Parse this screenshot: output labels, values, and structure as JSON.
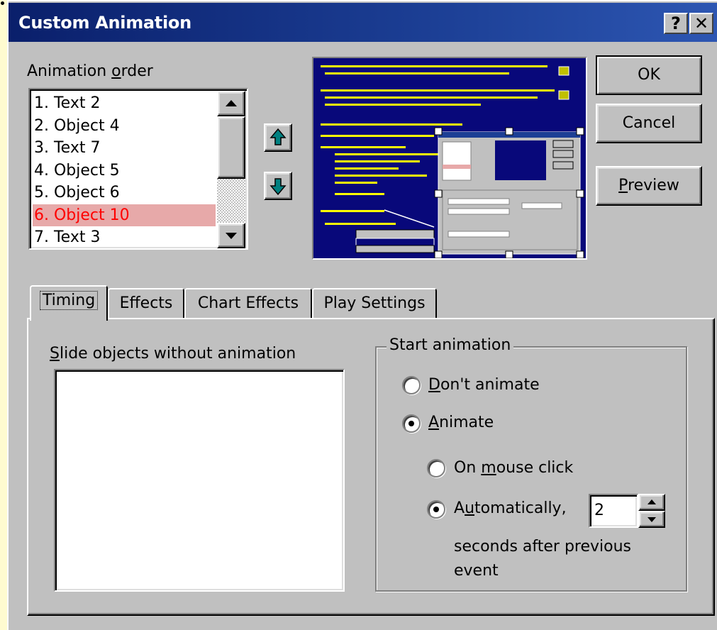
{
  "dialog": {
    "title": "Custom Animation",
    "help_glyph": "?",
    "close_glyph": "✕"
  },
  "animation_order": {
    "label_prefix": "Animation ",
    "label_accel": "o",
    "label_suffix": "rder",
    "items": [
      "1. Text 2",
      "2. Object 4",
      "3. Text 7",
      "4. Object 5",
      "5. Object 6",
      "6. Object 10",
      "7. Text 3"
    ],
    "selected_index": 5
  },
  "buttons": {
    "ok": "OK",
    "cancel": "Cancel",
    "preview_accel": "P",
    "preview_rest": "review"
  },
  "tabs": [
    "Timing",
    "Effects",
    "Chart Effects",
    "Play Settings"
  ],
  "timing": {
    "objects_label_accel": "S",
    "objects_label_rest": "lide objects without animation",
    "start_group_title": "Start animation",
    "dont_animate_accel": "D",
    "dont_animate_rest": "on't animate",
    "animate_accel": "A",
    "animate_rest": "nimate",
    "on_click_prefix": "On ",
    "on_click_accel": "m",
    "on_click_rest": "ouse click",
    "auto_prefix": "A",
    "auto_accel": "u",
    "auto_rest": "tomatically,",
    "seconds_value": "2",
    "seconds_line1": "seconds after previous",
    "seconds_line2": "event",
    "animate_selected": true,
    "automatic_selected": true
  },
  "colors": {
    "title_bar": "#0a1f6b",
    "selected_item_bg": "#e7a9a9",
    "selected_item_text": "#ff0000",
    "preview_bg": "#08087a",
    "preview_text": "#ffff00"
  },
  "icons": [
    "help-icon",
    "close-icon",
    "scroll-up-icon",
    "scroll-down-icon",
    "move-up-arrow-icon",
    "move-down-arrow-icon"
  ]
}
